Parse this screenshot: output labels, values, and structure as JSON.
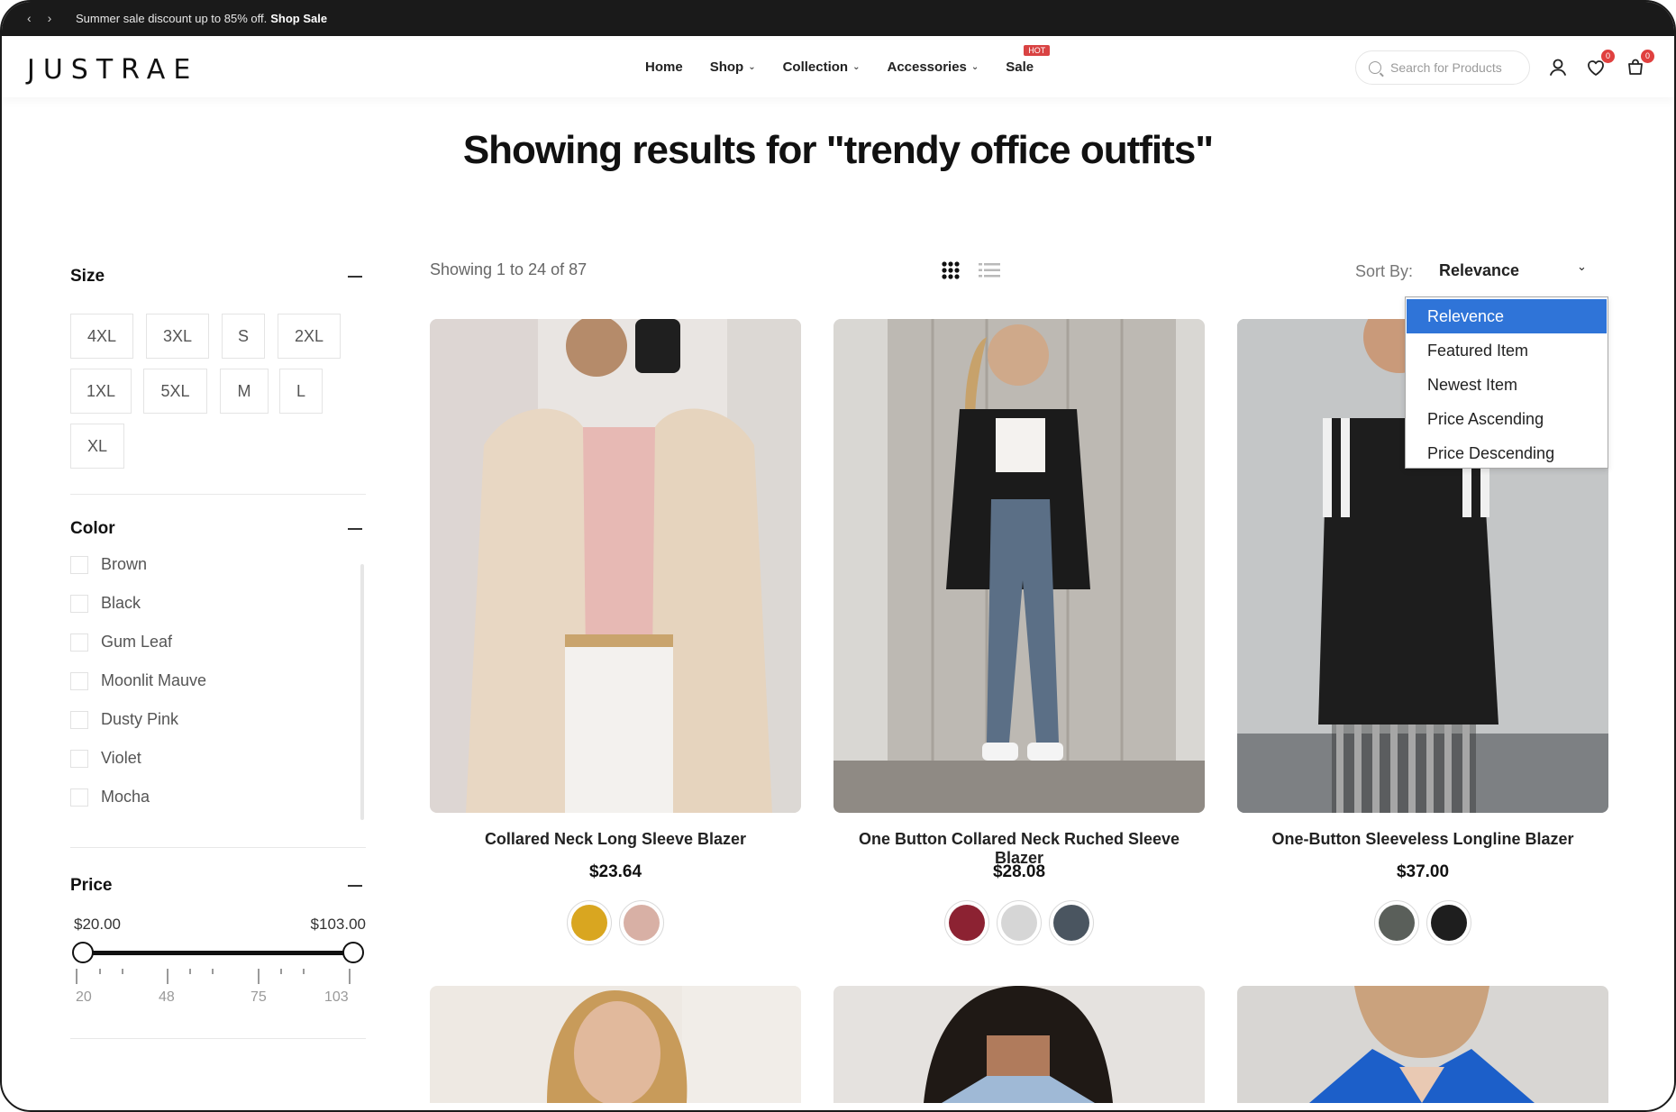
{
  "announcement": {
    "prev_icon": "chevron-left-icon",
    "next_icon": "chevron-right-icon",
    "text": "Summer sale discount up to 85% off.",
    "link": "Shop Sale"
  },
  "header": {
    "logo": "JUSTRAE",
    "nav": [
      {
        "label": "Home",
        "dropdown": false
      },
      {
        "label": "Shop",
        "dropdown": true
      },
      {
        "label": "Collection",
        "dropdown": true
      },
      {
        "label": "Accessories",
        "dropdown": true
      },
      {
        "label": "Sale",
        "dropdown": false,
        "badge": "HOT"
      }
    ],
    "search_placeholder": "Search for Products",
    "wishlist_count": "0",
    "cart_count": "0"
  },
  "page_title": "Showing results for \"trendy office outfits\"",
  "filters": {
    "size": {
      "title": "Size",
      "options": [
        "4XL",
        "3XL",
        "S",
        "2XL",
        "1XL",
        "5XL",
        "M",
        "L",
        "XL"
      ]
    },
    "color": {
      "title": "Color",
      "options": [
        "Brown",
        "Black",
        "Gum Leaf",
        "Moonlit Mauve",
        "Dusty Pink",
        "Violet",
        "Mocha"
      ]
    },
    "price": {
      "title": "Price",
      "min_label": "$20.00",
      "max_label": "$103.00",
      "min": 20,
      "max": 103,
      "ticks": [
        "20",
        "48",
        "75",
        "103"
      ]
    }
  },
  "toolbar": {
    "result_count": "Showing 1 to 24 of 87",
    "sort_label": "Sort By:",
    "sort_value": "Relevance",
    "sort_options": [
      "Relevence",
      "Featured Item",
      "Newest Item",
      "Price Ascending",
      "Price Descending"
    ],
    "sort_active_index": 0
  },
  "products": [
    {
      "name": "Collared Neck Long Sleeve Blazer",
      "price": "$23.64",
      "swatches": [
        "#d9a620",
        "#d8b0a5"
      ]
    },
    {
      "name": "One Button Collared Neck Ruched Sleeve Blazer",
      "price": "$28.08",
      "swatches": [
        "#8c2232",
        "#d6d6d6",
        "#4a5560"
      ]
    },
    {
      "name": "One-Button Sleeveless Longline Blazer",
      "price": "$37.00",
      "swatches": [
        "#5a5f5a",
        "#1e1e1e"
      ]
    }
  ]
}
